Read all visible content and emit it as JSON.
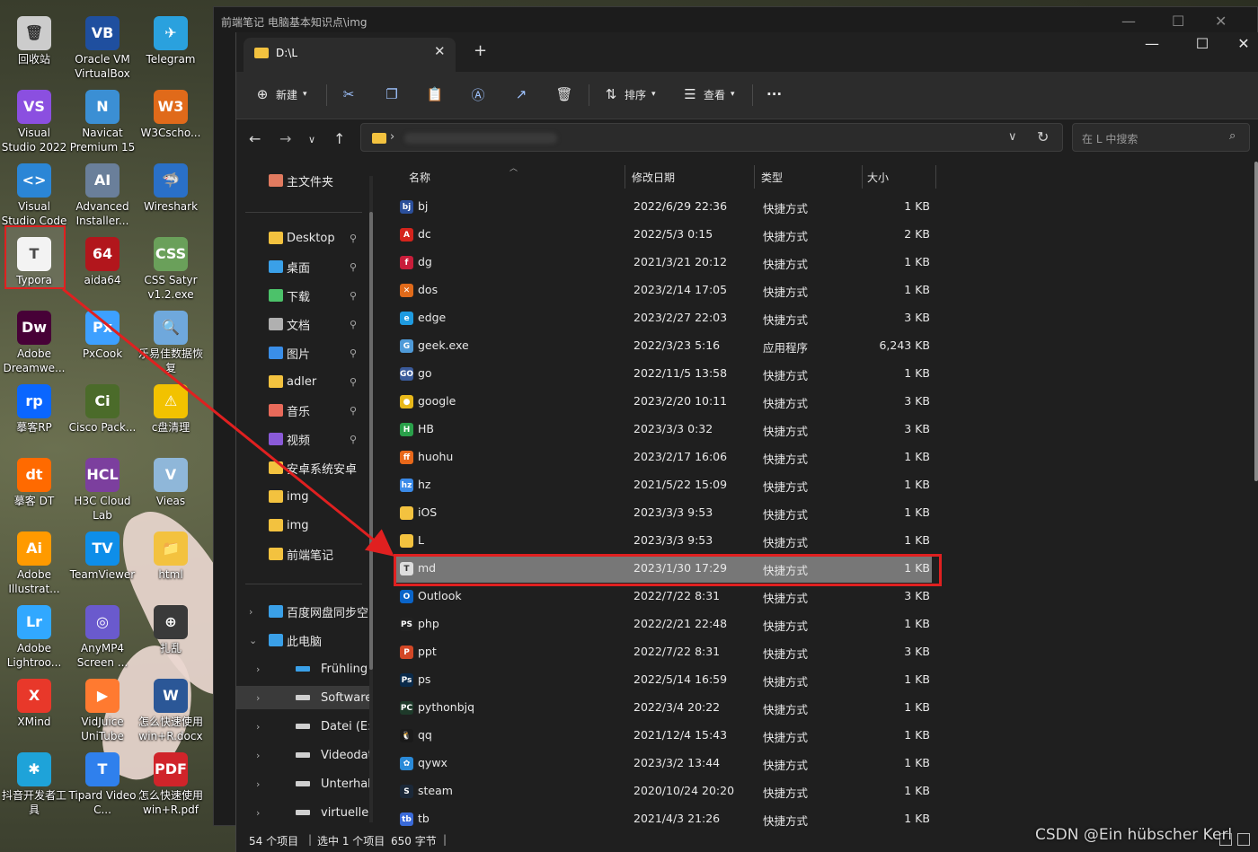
{
  "desktop": {
    "icons": [
      {
        "label": "回收站",
        "color": "#ccc"
      },
      {
        "label": "Oracle VM VirtualBox",
        "color": "#1f4f9f"
      },
      {
        "label": "Telegram",
        "color": "#2aa1de"
      },
      {
        "label": "Visual Studio 2022",
        "color": "#8b4fe0"
      },
      {
        "label": "Navicat Premium 15",
        "color": "#3b8fd4"
      },
      {
        "label": "W3Cscho...",
        "color": "#e06a1a"
      },
      {
        "label": "Visual Studio Code",
        "color": "#2b86d6"
      },
      {
        "label": "Advanced Installer...",
        "color": "#6a7f9a"
      },
      {
        "label": "Wireshark",
        "color": "#2a70c8"
      },
      {
        "label": "Typora",
        "color": "#f2f2f2"
      },
      {
        "label": "aida64",
        "color": "#b2161c"
      },
      {
        "label": "CSS Satyr v1.2.exe",
        "color": "#6aa05a"
      },
      {
        "label": "Adobe Dreamwe...",
        "color": "#470137"
      },
      {
        "label": "PxCook",
        "color": "#3da0ff"
      },
      {
        "label": "乐易佳数据恢复",
        "color": "#6fa8dc"
      },
      {
        "label": "摹客RP",
        "color": "#0a66ff"
      },
      {
        "label": "Cisco Pack...",
        "color": "#4b6b2a"
      },
      {
        "label": "c盘清理",
        "color": "#f2c200"
      },
      {
        "label": "摹客 DT",
        "color": "#ff6a00"
      },
      {
        "label": "H3C Cloud Lab",
        "color": "#7c3f9e"
      },
      {
        "label": "Vieas",
        "color": "#8fb7d9"
      },
      {
        "label": "Adobe Illustrat...",
        "color": "#ff9a00"
      },
      {
        "label": "TeamViewer",
        "color": "#0e8ee9"
      },
      {
        "label": "html",
        "color": "#f3c23f"
      },
      {
        "label": "Adobe Lightroo...",
        "color": "#31a8ff"
      },
      {
        "label": "AnyMP4 Screen ...",
        "color": "#6a5acd"
      },
      {
        "label": "扎乱",
        "color": "#3a3a3a"
      },
      {
        "label": "XMind",
        "color": "#e8382a"
      },
      {
        "label": "VidJuice UniTube",
        "color": "#ff7a30"
      },
      {
        "label": "怎么快速使用win+R.docx",
        "color": "#2b5797"
      },
      {
        "label": "抖音开发者工具",
        "color": "#1ea3d9"
      },
      {
        "label": "Tipard Video C...",
        "color": "#2f80ed"
      },
      {
        "label": "怎么快速使用win+R.pdf",
        "color": "#d0242a"
      }
    ],
    "icon_glyphs": [
      "🗑",
      "VB",
      "✈",
      "VS",
      "N",
      "W3",
      "<>",
      "AI",
      "🦈",
      "T",
      "64",
      "CSS",
      "Dw",
      "Px",
      "🔍",
      "rp",
      "Ci",
      "⚠",
      "dt",
      "HCL",
      "V",
      "Ai",
      "TV",
      "📁",
      "Lr",
      "◎",
      "⊕",
      "X",
      "▶",
      "W",
      "✱",
      "T",
      "PDF"
    ]
  },
  "bg_window": {
    "tab_title": "前端笔记 电脑基本知识点\\img"
  },
  "window": {
    "tab_title": "D:\\L",
    "new_tab": "+",
    "controls": {
      "minimize": "—",
      "maximize": "☐",
      "close": "✕"
    }
  },
  "toolbar": {
    "new_label": "新建",
    "sort_label": "排序",
    "view_label": "查看",
    "more_label": "···"
  },
  "nav": {
    "search_placeholder": "在 L 中搜索"
  },
  "sidebar": {
    "items": [
      {
        "label": "主文件夹",
        "icon": "home",
        "color": "#e07a5f",
        "pinned": false
      },
      {
        "label": "Desktop",
        "icon": "folder",
        "color": "#f3c23f",
        "pinned": true
      },
      {
        "label": "桌面",
        "icon": "desktop",
        "color": "#3aa0e8",
        "pinned": true
      },
      {
        "label": "下载",
        "icon": "download",
        "color": "#4cc26a",
        "pinned": true
      },
      {
        "label": "文档",
        "icon": "document",
        "color": "#b0b0b0",
        "pinned": true
      },
      {
        "label": "图片",
        "icon": "picture",
        "color": "#3a8ee8",
        "pinned": true
      },
      {
        "label": "adler",
        "icon": "folder",
        "color": "#f3c23f",
        "pinned": true
      },
      {
        "label": "音乐",
        "icon": "music",
        "color": "#e86a5a",
        "pinned": true
      },
      {
        "label": "视频",
        "icon": "video",
        "color": "#8a5ad8",
        "pinned": true
      },
      {
        "label": "安卓系统安卓",
        "icon": "folder",
        "color": "#f3c23f",
        "pinned": false
      },
      {
        "label": "img",
        "icon": "folder",
        "color": "#f3c23f",
        "pinned": false
      },
      {
        "label": "img",
        "icon": "folder",
        "color": "#f3c23f",
        "pinned": false
      },
      {
        "label": "前端笔记",
        "icon": "folder",
        "color": "#f3c23f",
        "pinned": false
      },
      {
        "label": "百度网盘同步空",
        "icon": "cloud",
        "color": "#3aa0e8",
        "pinned": false
      },
      {
        "label": "此电脑",
        "icon": "pc",
        "color": "#3aa0e8",
        "pinned": false
      },
      {
        "label": "Frühling anse",
        "icon": "drive",
        "color": "#3aa0e8",
        "pinned": false
      },
      {
        "label": "Software (D:)",
        "icon": "drive",
        "color": "#cfcfcf",
        "pinned": false
      },
      {
        "label": "Datei (E:)",
        "icon": "drive",
        "color": "#cfcfcf",
        "pinned": false
      },
      {
        "label": "Videodateien",
        "icon": "drive",
        "color": "#cfcfcf",
        "pinned": false
      },
      {
        "label": "Unterhaltung",
        "icon": "drive",
        "color": "#cfcfcf",
        "pinned": false
      },
      {
        "label": "virtuelle Masc",
        "icon": "drive",
        "color": "#cfcfcf",
        "pinned": false
      }
    ],
    "pin_glyph": "📌",
    "expand_glyph": "›"
  },
  "columns": {
    "name": "名称",
    "date": "修改日期",
    "type": "类型",
    "size": "大小"
  },
  "files": [
    {
      "name": "bj",
      "date": "2022/6/29 22:36",
      "type": "快捷方式",
      "size": "1 KB",
      "icon": "bj",
      "color": "#2b4f9a"
    },
    {
      "name": "dc",
      "date": "2022/5/3 0:15",
      "type": "快捷方式",
      "size": "2 KB",
      "icon": "A",
      "color": "#d4241c"
    },
    {
      "name": "dg",
      "date": "2021/3/21 20:12",
      "type": "快捷方式",
      "size": "1 KB",
      "icon": "f",
      "color": "#c81d3a"
    },
    {
      "name": "dos",
      "date": "2023/2/14 17:05",
      "type": "快捷方式",
      "size": "1 KB",
      "icon": "✕",
      "color": "#e06a1a"
    },
    {
      "name": "edge",
      "date": "2023/2/27 22:03",
      "type": "快捷方式",
      "size": "3 KB",
      "icon": "e",
      "color": "#1f9be0"
    },
    {
      "name": "geek.exe",
      "date": "2022/3/23 5:16",
      "type": "应用程序",
      "size": "6,243 KB",
      "icon": "G",
      "color": "#4e9ad8"
    },
    {
      "name": "go",
      "date": "2022/11/5 13:58",
      "type": "快捷方式",
      "size": "1 KB",
      "icon": "GO",
      "color": "#3a5a9a"
    },
    {
      "name": "google",
      "date": "2023/2/20 10:11",
      "type": "快捷方式",
      "size": "3 KB",
      "icon": "●",
      "color": "#e8b81a"
    },
    {
      "name": "HB",
      "date": "2023/3/3 0:32",
      "type": "快捷方式",
      "size": "3 KB",
      "icon": "H",
      "color": "#2aa04a"
    },
    {
      "name": "huohu",
      "date": "2023/2/17 16:06",
      "type": "快捷方式",
      "size": "1 KB",
      "icon": "ff",
      "color": "#e8681a"
    },
    {
      "name": "hz",
      "date": "2021/5/22 15:09",
      "type": "快捷方式",
      "size": "1 KB",
      "icon": "hz",
      "color": "#3a8ae8"
    },
    {
      "name": "iOS",
      "date": "2023/3/3 9:53",
      "type": "快捷方式",
      "size": "1 KB",
      "icon": "",
      "color": "#f3c23f"
    },
    {
      "name": "L",
      "date": "2023/3/3 9:53",
      "type": "快捷方式",
      "size": "1 KB",
      "icon": "",
      "color": "#f3c23f"
    },
    {
      "name": "md",
      "date": "2023/1/30 17:29",
      "type": "快捷方式",
      "size": "1 KB",
      "icon": "T",
      "color": "#dddddd",
      "selected": true
    },
    {
      "name": "Outlook",
      "date": "2022/7/22 8:31",
      "type": "快捷方式",
      "size": "3 KB",
      "icon": "O",
      "color": "#0a64c8"
    },
    {
      "name": "php",
      "date": "2022/2/21 22:48",
      "type": "快捷方式",
      "size": "1 KB",
      "icon": "PS",
      "color": "#222222"
    },
    {
      "name": "ppt",
      "date": "2022/7/22 8:31",
      "type": "快捷方式",
      "size": "3 KB",
      "icon": "P",
      "color": "#d24726"
    },
    {
      "name": "ps",
      "date": "2022/5/14 16:59",
      "type": "快捷方式",
      "size": "1 KB",
      "icon": "Ps",
      "color": "#0a2a4a"
    },
    {
      "name": "pythonbjq",
      "date": "2022/3/4 20:22",
      "type": "快捷方式",
      "size": "1 KB",
      "icon": "PC",
      "color": "#1e3a2a"
    },
    {
      "name": "qq",
      "date": "2021/12/4 15:43",
      "type": "快捷方式",
      "size": "1 KB",
      "icon": "🐧",
      "color": "#1a1a1a"
    },
    {
      "name": "qywx",
      "date": "2023/3/2 13:44",
      "type": "快捷方式",
      "size": "1 KB",
      "icon": "✿",
      "color": "#2a8ad8"
    },
    {
      "name": "steam",
      "date": "2020/10/24 20:20",
      "type": "快捷方式",
      "size": "1 KB",
      "icon": "S",
      "color": "#1b2838"
    },
    {
      "name": "tb",
      "date": "2021/4/3 21:26",
      "type": "快捷方式",
      "size": "1 KB",
      "icon": "tb",
      "color": "#3a6ad8"
    }
  ],
  "status": {
    "count": "54 个项目",
    "selected": "选中 1 个项目",
    "size": "650 字节",
    "sep": "|"
  },
  "watermark": "CSDN @Ein hübscher Kerl",
  "accent": "#e02020"
}
